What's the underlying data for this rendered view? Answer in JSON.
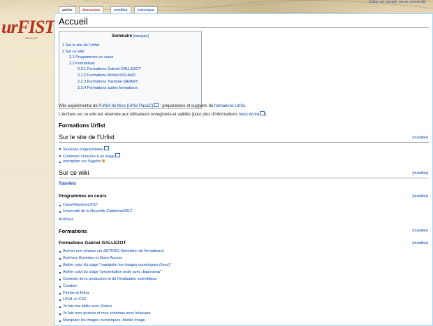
{
  "personal": {
    "login_label": "Créer un compte ou se connecter"
  },
  "logo": {
    "text": "urFIST",
    "sub": "PACA-NC"
  },
  "tabs": [
    {
      "label": "article"
    },
    {
      "label": "discussion"
    },
    {
      "label": "modifier"
    },
    {
      "label": "historique"
    }
  ],
  "page": {
    "title": "Accueil"
  },
  "toc": {
    "title": "Sommaire",
    "toggle": "[masquer]",
    "items": [
      "1 Sur le site de l'Urfist",
      "2 Sur ce wiki",
      "2.1 Programmes en cours",
      "2.2 Formations",
      "2.2.1 Formations Gabriel GALLEZOT",
      "2.2.2 Formations Michel ROLAND",
      "2.2.3 Formations Yasmine SAVARY",
      "2.2.4 Formations autres formateurs"
    ]
  },
  "intro": {
    "p1_a": "Wiki expérimental de l'",
    "p1_link": "Urfist de Nice (Urfist PacaC)",
    "p1_b": " : préparations et supports de ",
    "p1_link2": "formations Urfist",
    "p1_c": ".",
    "p2_a": "L'écriture sur ce wiki est réservée aux utilisateurs enregistrés et validés (pour plus d'informations ",
    "p2_link": "nous écrire",
    "p2_c": ")."
  },
  "sections": {
    "formations_urfist": "Formations Urfist",
    "site": "Sur le site de l'Urfist",
    "wiki": "Sur ce wiki",
    "tutoriels": "Tutoriels",
    "programmes": "Programmes en cours",
    "archives": "Archives",
    "formations": "Formations",
    "gallezot": "Formations Gabriel GALLEZOT",
    "edit": "modifier"
  },
  "site_links": [
    "Sessions programmées",
    "Comment s'inscrire à un stage",
    "Inscription sur Sygefor"
  ],
  "programmes_links": [
    "CasaVelazquez2017",
    "Université de la Nouvelle Calédonie2017"
  ],
  "gallezot_links": [
    "Animer une séance sur ZOTERO (formation de formateurs)",
    "Archives Ouvertes et Open Access",
    "Atelier suivi du stage \"manipuler les images numériques (fixes)\"",
    "Atelier suivi du stage \"présentation orale avec diaporama\"",
    "Contexte de la production et de l'évaluation scientifique",
    "Curation",
    "Firefox et Koha",
    "HTML et CSS",
    "Je fais ma biblio avec Zotero",
    "Je fais mes posters et mes schémas avec Inkscape",
    "Manipuler les images numériques- Atelier Image"
  ]
}
